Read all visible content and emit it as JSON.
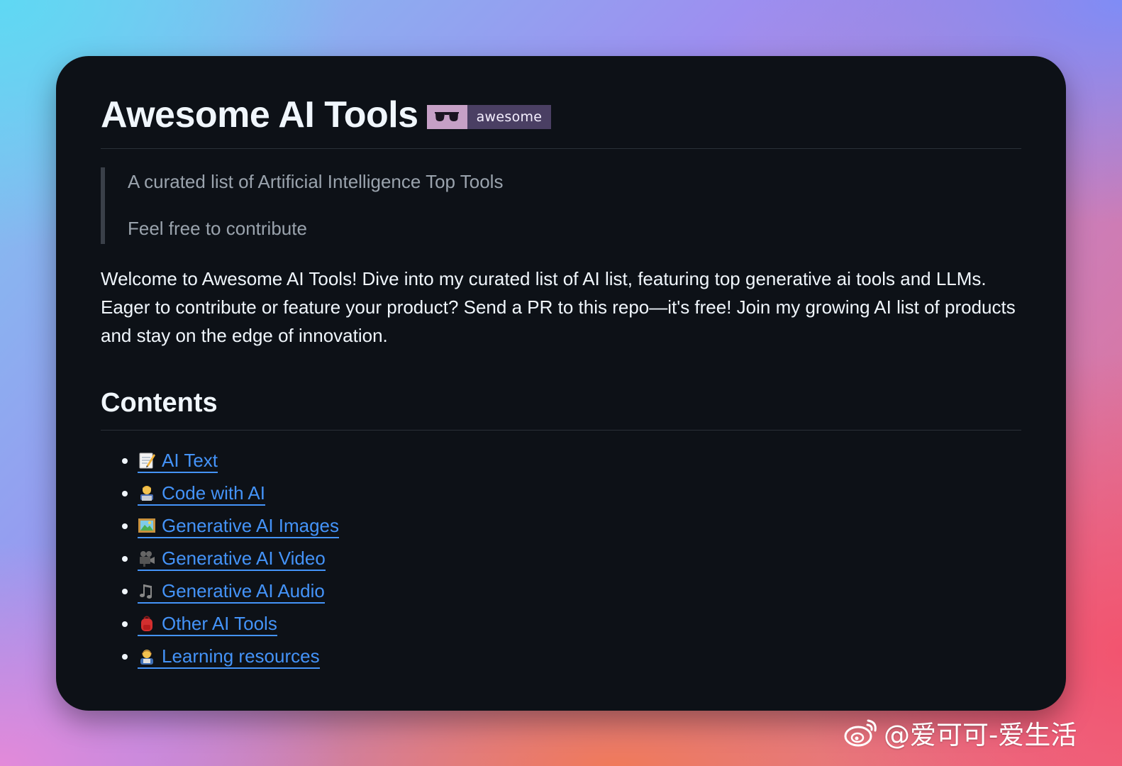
{
  "header": {
    "title": "Awesome AI Tools",
    "badge_label": "awesome",
    "badge_icon": "sunglasses-icon"
  },
  "quote": {
    "line1": "A curated list of Artificial Intelligence Top Tools",
    "line2": "Feel free to contribute"
  },
  "intro": "Welcome to Awesome AI Tools! Dive into my curated list of AI list, featuring top generative ai tools and LLMs. Eager to contribute or feature your product? Send a PR to this repo—it's free! Join my growing AI list of products and stay on the edge of innovation.",
  "contents": {
    "title": "Contents",
    "items": [
      {
        "label": "AI Text",
        "icon": "memo-icon"
      },
      {
        "label": "Code with AI",
        "icon": "technologist-icon"
      },
      {
        "label": "Generative AI Images",
        "icon": "framed-picture-icon"
      },
      {
        "label": "Generative AI Video",
        "icon": "movie-camera-icon"
      },
      {
        "label": "Generative AI Audio",
        "icon": "musical-notes-icon"
      },
      {
        "label": "Other AI Tools",
        "icon": "backpack-icon"
      },
      {
        "label": "Learning resources",
        "icon": "teacher-icon"
      }
    ]
  },
  "watermark": {
    "text": "@爱可可-爱生活",
    "icon": "weibo-icon"
  },
  "colors": {
    "card_background": "#0d1117",
    "link": "#4493f8",
    "badge_left": "#c6a0c6",
    "badge_right": "#4a3f63"
  }
}
